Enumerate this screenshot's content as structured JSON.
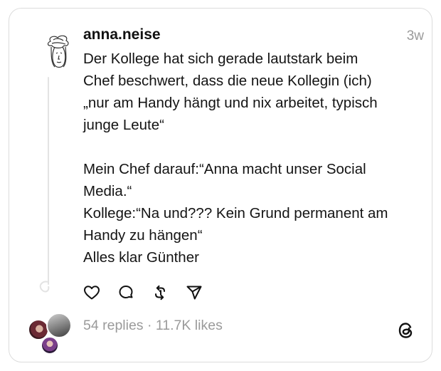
{
  "post": {
    "username": "anna.neise",
    "timestamp": "3w",
    "lines": [
      "Der Kollege hat sich gerade lautstark beim",
      "Chef beschwert, dass die neue Kollegin (ich)",
      "„nur am Handy hängt und nix arbeitet, typisch",
      "junge Leute“",
      "",
      "Mein Chef darauf:“Anna macht unser Social",
      "Media.“",
      "Kollege:“Na und??? Kein Grund permanent am",
      "Handy zu hängen“",
      "Alles klar Günther"
    ],
    "actions": [
      {
        "name": "like-icon"
      },
      {
        "name": "comment-icon"
      },
      {
        "name": "repost-icon"
      },
      {
        "name": "share-icon"
      }
    ],
    "stats": {
      "text": "54 replies · 11.7K likes"
    }
  },
  "icons": {
    "threads": "threads-logo-icon",
    "avatar": "sketch-avatar-icon"
  },
  "colors": {
    "text": "#141414",
    "muted": "#9a9a9a",
    "border": "#dcdcdc"
  }
}
